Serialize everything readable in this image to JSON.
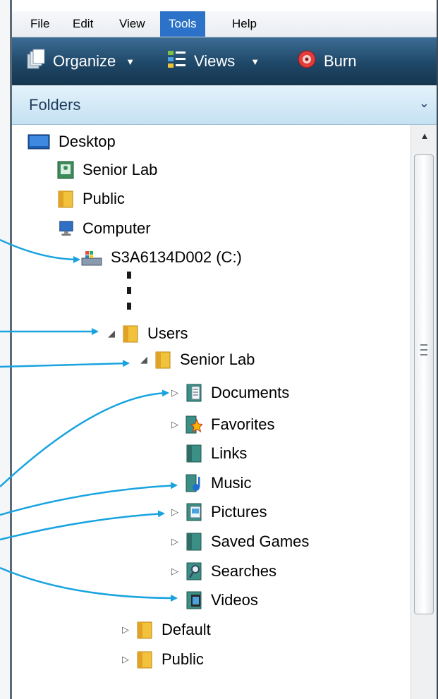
{
  "menu": {
    "items": [
      {
        "label": "File"
      },
      {
        "label": "Edit"
      },
      {
        "label": "View"
      },
      {
        "label": "Tools",
        "active": true
      },
      {
        "label": "Help"
      }
    ]
  },
  "toolbar": {
    "organize_label": "Organize",
    "views_label": "Views",
    "burn_label": "Burn"
  },
  "folders": {
    "title": "Folders"
  },
  "tree": {
    "desktop": "Desktop",
    "senior_lab_user": "Senior Lab",
    "public_top": "Public",
    "computer": "Computer",
    "drive": "S3A6134D002 (C:)",
    "users": "Users",
    "senior_lab": "Senior Lab",
    "documents": "Documents",
    "favorites": "Favorites",
    "links": "Links",
    "music": "Music",
    "pictures": "Pictures",
    "saved_games": "Saved Games",
    "searches": "Searches",
    "videos": "Videos",
    "default": "Default",
    "public": "Public"
  },
  "colors": {
    "menu_active": "#2d72c9",
    "toolbar": "#1f4767",
    "folders_header": "#c5e1f2",
    "callout_arrow": "#18a3e0"
  },
  "icons": {
    "desktop": "desktop-icon",
    "user": "user-folder-icon",
    "folder": "folder-icon",
    "computer": "computer-icon",
    "drive": "hard-drive-icon",
    "documents": "documents-icon",
    "favorites": "favorites-star-icon",
    "links": "links-icon",
    "music": "music-note-icon",
    "pictures": "pictures-icon",
    "saved_games": "saved-games-icon",
    "searches": "search-icon",
    "videos": "film-icon"
  }
}
